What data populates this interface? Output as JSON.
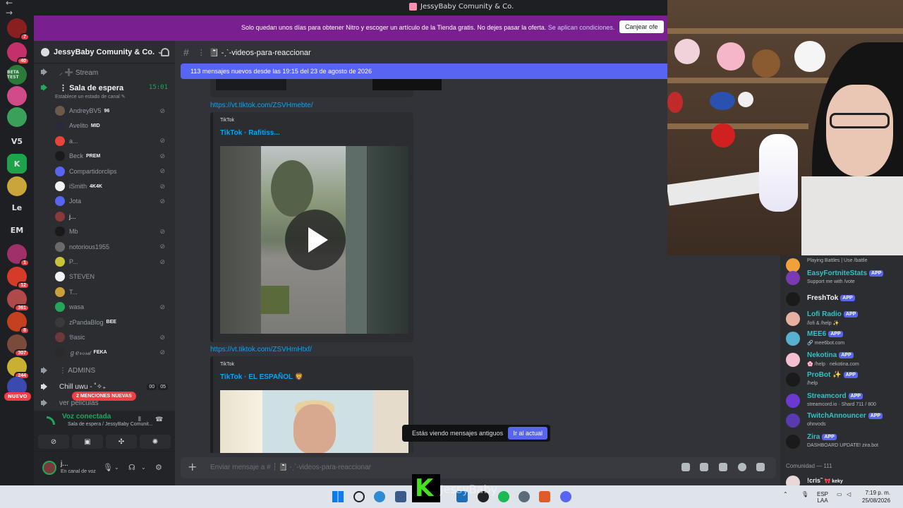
{
  "window": {
    "title": "JessyBaby Comunity & Co.",
    "nav": "← →"
  },
  "guilds": [
    {
      "label": "",
      "color": "#8a1f1f",
      "badge": "7"
    },
    {
      "label": "",
      "color": "#c4306a",
      "badge": "40"
    },
    {
      "label": "BETA TEST",
      "color": "#2b7a3a",
      "badge": ""
    },
    {
      "label": "",
      "color": "#d14a8a",
      "badge": ""
    },
    {
      "label": "",
      "color": "#3aa05a",
      "badge": ""
    },
    {
      "label": "V5",
      "color": "#1e1f22",
      "badge": ""
    },
    {
      "label": "K",
      "color": "#1fa34a",
      "badge": ""
    },
    {
      "label": "",
      "color": "#c9a53a",
      "badge": ""
    },
    {
      "label": "Le",
      "color": "#1e1f22",
      "badge": ""
    },
    {
      "label": "EM",
      "color": "#1e1f22",
      "badge": ""
    },
    {
      "label": "",
      "color": "#a0306a",
      "badge": "1"
    },
    {
      "label": "",
      "color": "#d83a2a",
      "badge": "12"
    },
    {
      "label": "",
      "color": "#b04a4a",
      "badge": "361"
    },
    {
      "label": "",
      "color": "#c4401f",
      "badge": "8"
    },
    {
      "label": "",
      "color": "#7a4a3a",
      "badge": "307"
    },
    {
      "label": "",
      "color": "#c9b030",
      "badge": "244"
    },
    {
      "label": "",
      "color": "#3a4ab0",
      "badge": ""
    }
  ],
  "nuevo_label": "NUEVO",
  "banner": {
    "text": "Solo quedan unos días para obtener Nitro y escoger un artículo de la Tienda gratis. No dejes pasar la oferta.",
    "link": "Se aplican condiciones.",
    "button": "Canjear ofe"
  },
  "server": {
    "name": "JessyBaby Comunity & Co."
  },
  "channels": {
    "stream": "Stream",
    "waiting": "Sala de espera",
    "waiting_timer": "15:01",
    "status_hint": "Establece un estado de canal",
    "admins": "ADMINS",
    "chill": "Chill uwu - ˚✧₊",
    "chill_counts": [
      "00",
      "05"
    ],
    "movies": "ver peliculas",
    "mentions_pill": "2 MENCIONES NUEVAS"
  },
  "members": [
    {
      "name": "AndreyBV5",
      "tag": "96",
      "color": "#6b5a4a",
      "muted": true
    },
    {
      "name": "Avelito",
      "tag": "MID",
      "color": "#2a2a3a",
      "muted": false
    },
    {
      "name": "a...",
      "tag": "",
      "color": "#e8453a",
      "muted": true
    },
    {
      "name": "Beck",
      "tag": "PREM",
      "color": "#1a1a1a",
      "muted": true
    },
    {
      "name": "Compartidorclips",
      "tag": "",
      "color": "#5865f2",
      "muted": true
    },
    {
      "name": "iSmith",
      "tag": "4K4K",
      "color": "#f2f3f5",
      "muted": true
    },
    {
      "name": "Jota",
      "tag": "",
      "color": "#5865f2",
      "muted": true
    },
    {
      "name": "j...",
      "tag": "",
      "color": "#8a3a3a",
      "muted": false
    },
    {
      "name": "Mb",
      "tag": "",
      "color": "#1a1a1a",
      "muted": true
    },
    {
      "name": "notorious1955",
      "tag": "",
      "color": "#6a6a6a",
      "muted": true
    },
    {
      "name": "P...",
      "tag": "",
      "color": "#c9c23a",
      "muted": true
    },
    {
      "name": "STEVEN",
      "tag": "",
      "color": "#f2f3f5",
      "muted": false
    },
    {
      "name": "T...",
      "tag": "",
      "color": "#c9a03a",
      "muted": false
    },
    {
      "name": "wasa",
      "tag": "",
      "color": "#23a55a",
      "muted": true
    },
    {
      "name": "zPandaBlog",
      "tag": "BEE",
      "color": "#3a3a3a",
      "muted": false
    },
    {
      "name": "𝔅asic",
      "tag": "",
      "color": "#6a3a3a",
      "muted": true
    },
    {
      "name": "ℊℯ𝓇ℴ𝓇𝒹",
      "tag": "FEKA",
      "color": "#2a2a2a",
      "muted": true
    }
  ],
  "voice": {
    "title": "Voz conectada",
    "subtitle": "Sala de espera / JessyBaby Comunit..."
  },
  "user": {
    "name": "j...",
    "status": "En canal de voz"
  },
  "chat": {
    "channel": "-ˏˋ-videos-para-reaccionar",
    "new_messages": "113 mensajes nuevos desde las 19:15 del 23 de agosto de 2026",
    "link1": "https://vt.tiktok.com/ZSVHmebte/",
    "embed1_provider": "TikTok",
    "embed1_title": "TikTok · Rafitiss...",
    "link2": "https://vt.tiktok.com/ZSVHmHtxf/",
    "embed2_provider": "TikTok",
    "embed2_title": "TikTok · EL ESPAÑOL 🦁",
    "old_messages": "Estás viendo mensajes antiguos",
    "jump": "Ir al actual",
    "placeholder": "Enviar mensaje a # ┆ 📓 -ˏˋ-videos-para-reaccionar"
  },
  "bots": [
    {
      "name": "",
      "sub": "Playing Battles | Use /battle",
      "color": "#f2a03a"
    },
    {
      "name": "EasyFortniteStats",
      "sub": "Support me with /vote",
      "color": "#7a3ab0"
    },
    {
      "name": "FreshTok",
      "sub": "",
      "color": "#1a1a1a"
    },
    {
      "name": "Lofi Radio",
      "sub": "/lofi & /help ✨",
      "color": "#e8b0a0"
    },
    {
      "name": "MEE6",
      "sub": "🔗 mee6bot.com",
      "color": "#5ab0d0"
    },
    {
      "name": "Nekotina",
      "sub": "🌸 /help · nekotina.com",
      "color": "#f2c0d0"
    },
    {
      "name": "ProBot ✨",
      "sub": "/help",
      "color": "#1a1a1a"
    },
    {
      "name": "Streamcord",
      "sub": "streamcord.io · Shard 711 / 800",
      "color": "#6a3ad0"
    },
    {
      "name": "TwitchAnnouncer",
      "sub": "ohnvods",
      "color": "#5a3ab0"
    },
    {
      "name": "Zira",
      "sub": "DASHBOARD UPDATE! zira.bot",
      "color": "#1a1a1a"
    }
  ],
  "bot_app_label": "APP",
  "bot_name_colors": [
    "#23a55a",
    "#2dc5c5",
    "#f2f3f5",
    "#2dc5c5",
    "#2dc5c5",
    "#2dc5c5",
    "#2dc5c5",
    "#2dc5c5",
    "#2dc5c5",
    "#2dc5c5"
  ],
  "community": {
    "header": "Comunidad — 111",
    "first_member": "!cris˜",
    "first_tag": "keky"
  },
  "overlay": {
    "logo": "K",
    "name": "JessyBaby"
  },
  "taskbar": {
    "lang1": "ESP",
    "lang2": "LAA",
    "time": "7:19 p. m.",
    "date": "25/08/2026"
  }
}
